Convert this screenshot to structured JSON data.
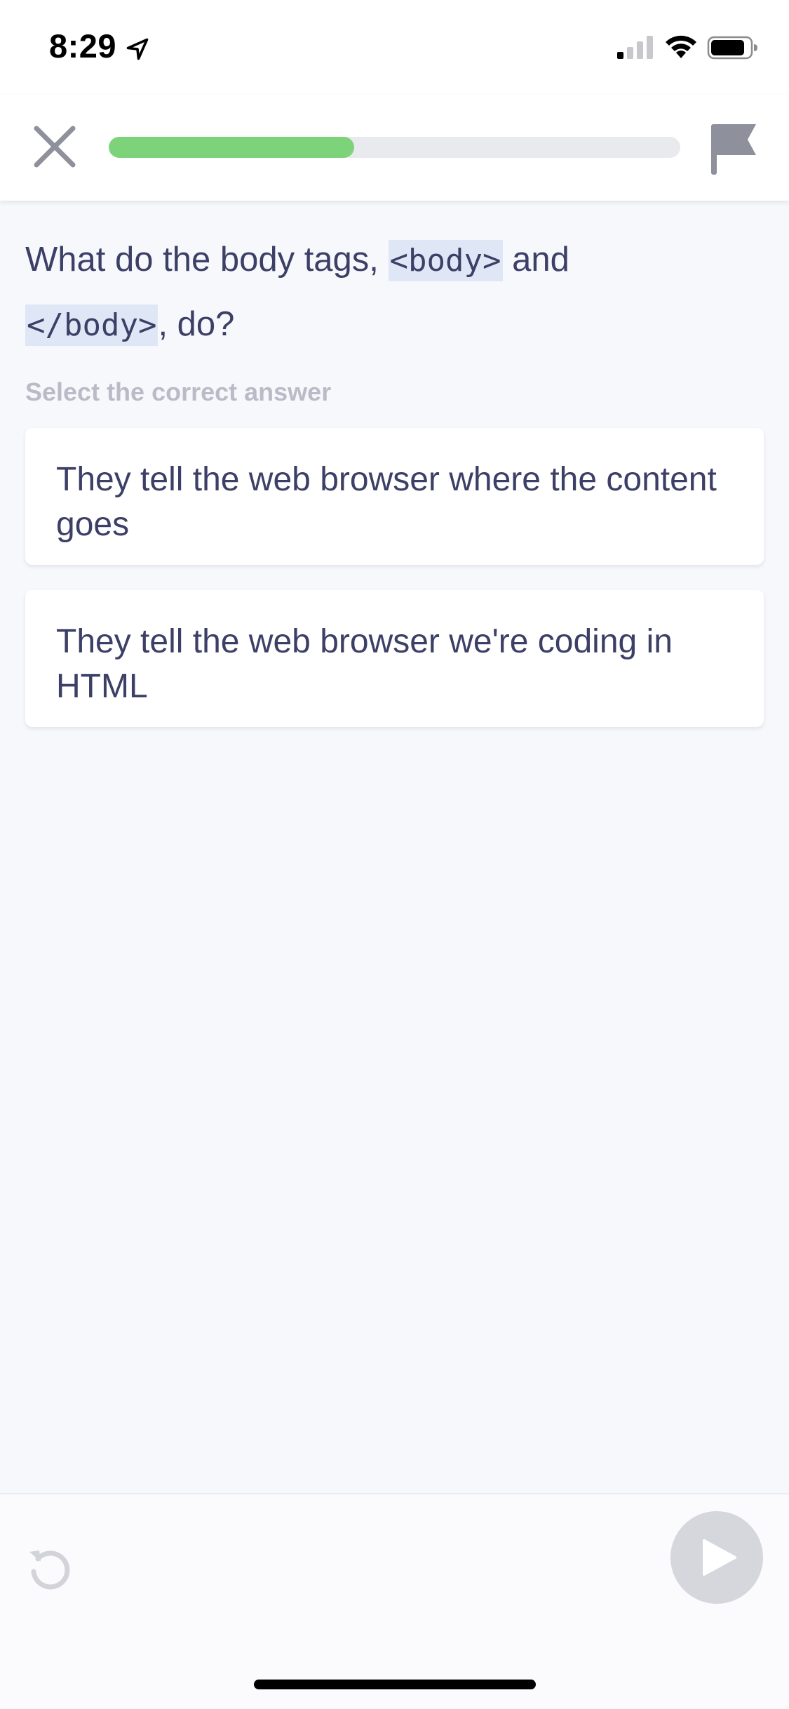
{
  "status_bar": {
    "time": "8:29",
    "icons": [
      "location-arrow-icon",
      "cellular-signal-icon",
      "wifi-icon",
      "battery-icon"
    ]
  },
  "header": {
    "progress_fraction": 0.43,
    "progress_color": "#7dd37a",
    "icons": [
      "close-icon",
      "flag-icon"
    ]
  },
  "question": {
    "prefix": "What do the body tags, ",
    "code_open": "<body>",
    "middle": " and",
    "code_close": "</body>",
    "suffix": ", do?",
    "instruction": "Select the correct answer"
  },
  "answers": [
    {
      "label": "They tell the web browser where the content goes"
    },
    {
      "label": "They tell the web browser we're coding in HTML"
    }
  ],
  "footer": {
    "icons": [
      "undo-icon",
      "play-icon"
    ]
  }
}
